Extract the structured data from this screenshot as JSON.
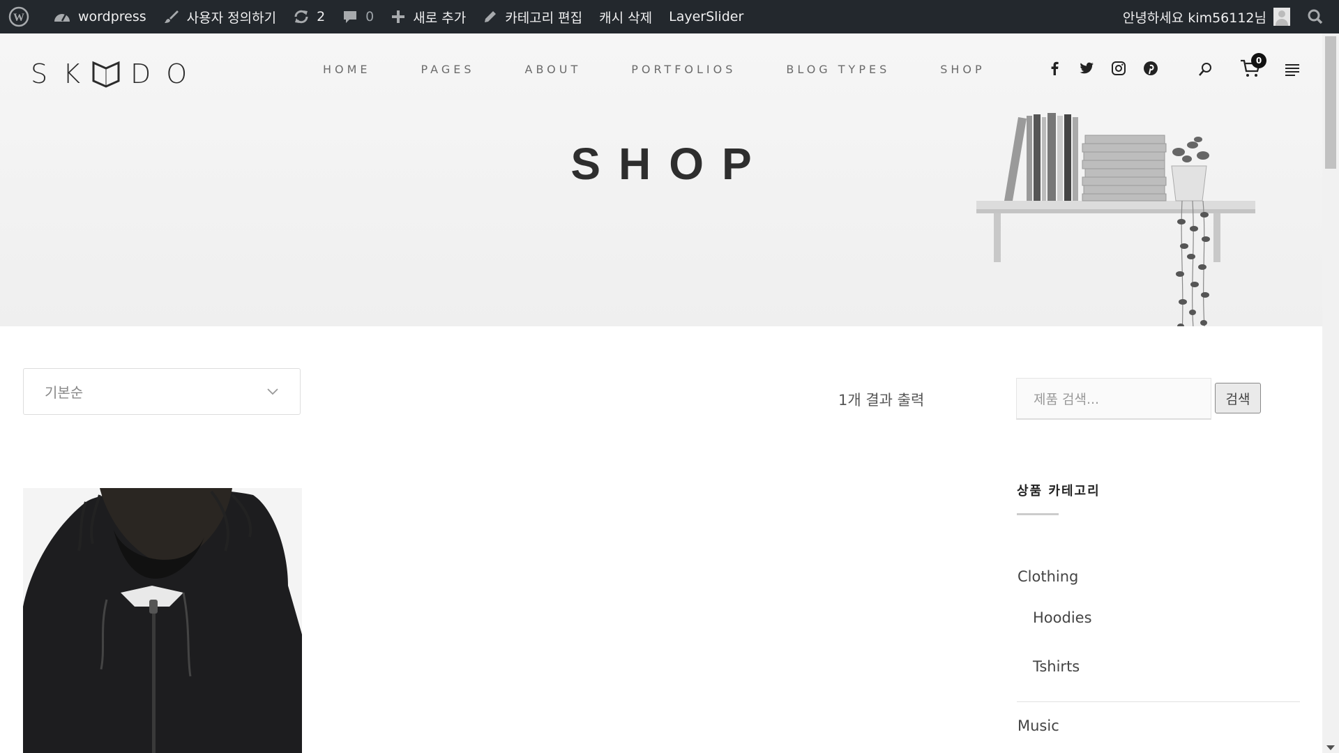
{
  "admin_bar": {
    "site_name": "wordpress",
    "customize": "사용자 정의하기",
    "updates_count": "2",
    "comments_count": "0",
    "new_label": "새로 추가",
    "edit_category": "카테고리 편집",
    "clear_cache": "캐시 삭제",
    "layerslider": "LayerSlider",
    "greeting": "안녕하세요 kim56112님"
  },
  "header": {
    "logo_left": "SK",
    "logo_right": "DO",
    "nav": [
      "HOME",
      "PAGES",
      "ABOUT",
      "PORTFOLIOS",
      "BLOG TYPES",
      "SHOP"
    ],
    "social_icons": [
      "facebook-icon",
      "twitter-icon",
      "instagram-icon",
      "pinterest-icon"
    ],
    "cart_count": "0"
  },
  "hero": {
    "title": "SHOP"
  },
  "shop": {
    "sort_value": "기본순",
    "result_count": "1개 결과 출력"
  },
  "sidebar": {
    "search_placeholder": "제품 검색...",
    "search_button": "검색",
    "categories_title": "상품 카테고리",
    "categories": [
      {
        "label": "Clothing"
      },
      {
        "label": "Hoodies"
      },
      {
        "label": "Tshirts"
      },
      {
        "label": "Music"
      }
    ]
  },
  "colors": {
    "admin_bar_bg": "#23282d",
    "hero_bg": "#f3f3f3",
    "text": "#333333"
  }
}
